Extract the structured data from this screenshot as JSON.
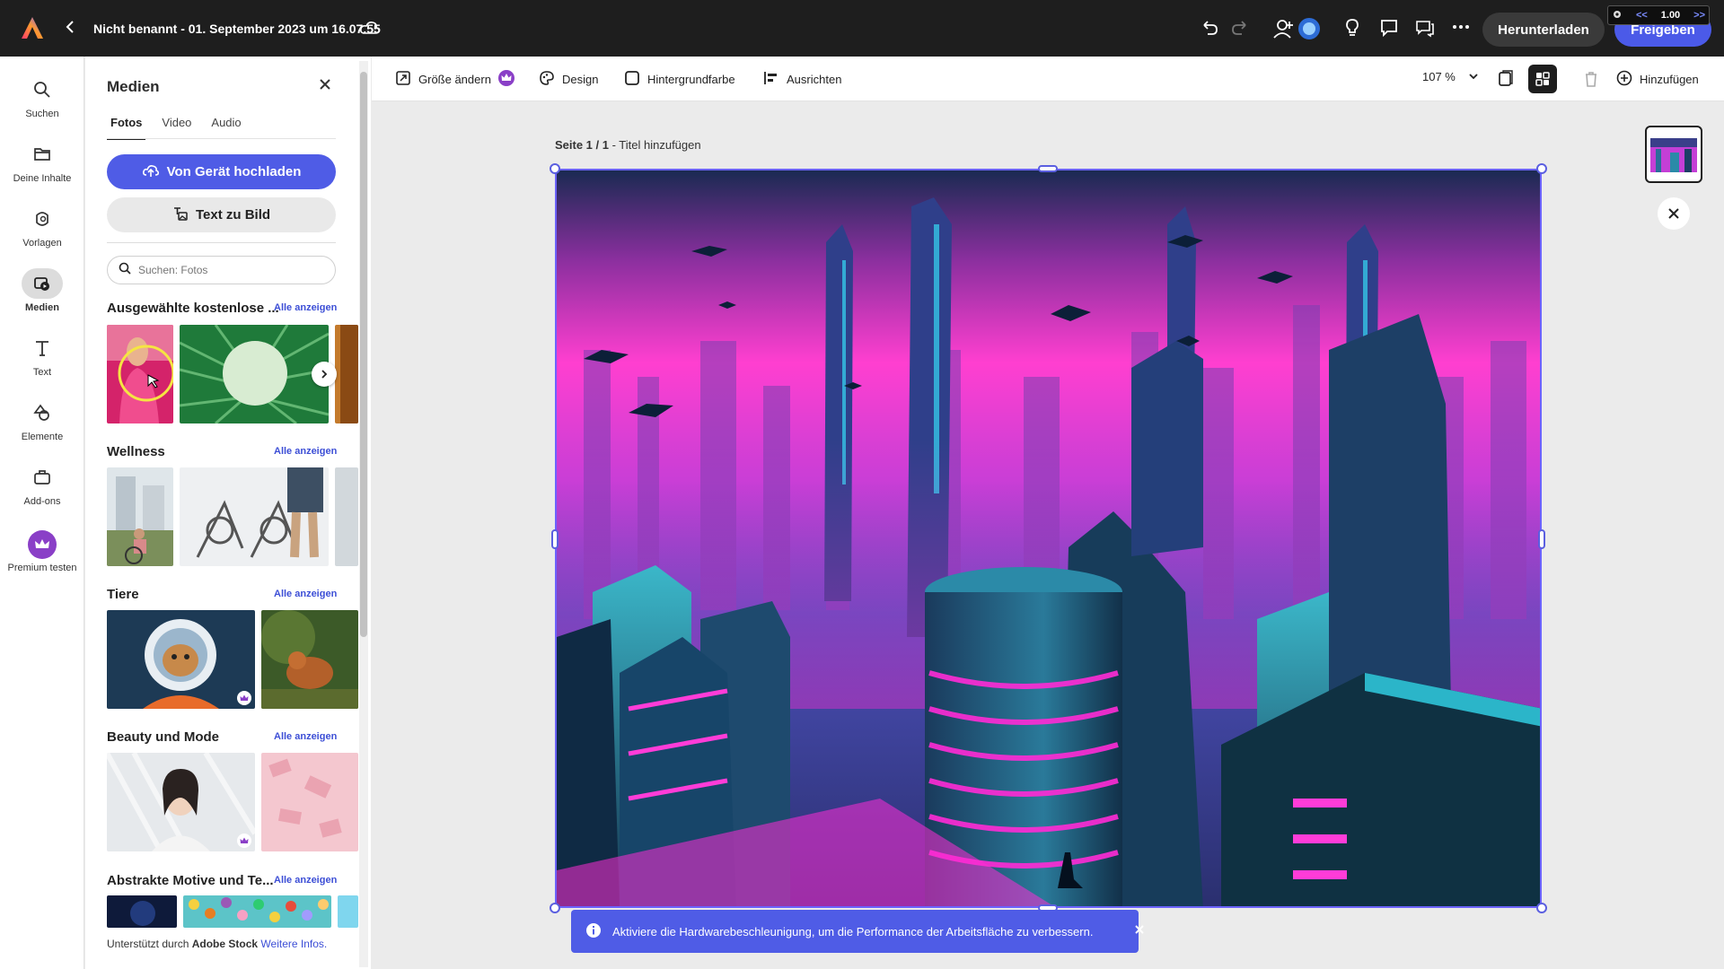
{
  "topbar": {
    "document_title": "Nicht benannt - 01. September 2023 um 16.07.55",
    "download_label": "Herunterladen",
    "share_label": "Freigeben",
    "speed_value": "1.00",
    "speed_prev": "<<",
    "speed_next": ">>"
  },
  "rail": {
    "items": [
      {
        "label": "Suchen",
        "icon": "search-icon"
      },
      {
        "label": "Deine Inhalte",
        "icon": "folder-icon"
      },
      {
        "label": "Vorlagen",
        "icon": "templates-icon"
      },
      {
        "label": "Medien",
        "icon": "media-icon",
        "active": true
      },
      {
        "label": "Text",
        "icon": "text-icon"
      },
      {
        "label": "Elemente",
        "icon": "elements-icon"
      },
      {
        "label": "Add-ons",
        "icon": "addons-icon"
      },
      {
        "label": "Premium testen",
        "icon": "crown-icon"
      }
    ]
  },
  "panel": {
    "title": "Medien",
    "tabs": [
      "Fotos",
      "Video",
      "Audio"
    ],
    "upload_label": "Von Gerät hochladen",
    "text_to_image_label": "Text zu Bild",
    "search_placeholder": "Suchen: Fotos",
    "see_all": "Alle anzeigen",
    "sections": [
      {
        "title": "Ausgewählte kostenlose ..."
      },
      {
        "title": "Wellness"
      },
      {
        "title": "Tiere"
      },
      {
        "title": "Beauty und Mode"
      },
      {
        "title": "Abstrakte Motive und Te..."
      }
    ],
    "footer_prefix": "Unterstützt durch ",
    "footer_brand": "Adobe Stock",
    "footer_link": "Weitere Infos."
  },
  "toolbar": {
    "resize_label": "Größe ändern",
    "design_label": "Design",
    "background_label": "Hintergrundfarbe",
    "align_label": "Ausrichten",
    "zoom": "107 %",
    "add_label": "Hinzufügen"
  },
  "canvas": {
    "page_label": "Seite 1 / 1",
    "page_title_hint": " - Titel hinzufügen"
  },
  "toast": {
    "message": "Aktiviere die Hardwarebeschleunigung, um die Performance der Arbeitsfläche zu verbessern."
  },
  "colors": {
    "accent": "#4f5ce6",
    "topbar": "#1e1e1e",
    "selection": "#6c63ff",
    "premium": "#8a3fc7"
  }
}
